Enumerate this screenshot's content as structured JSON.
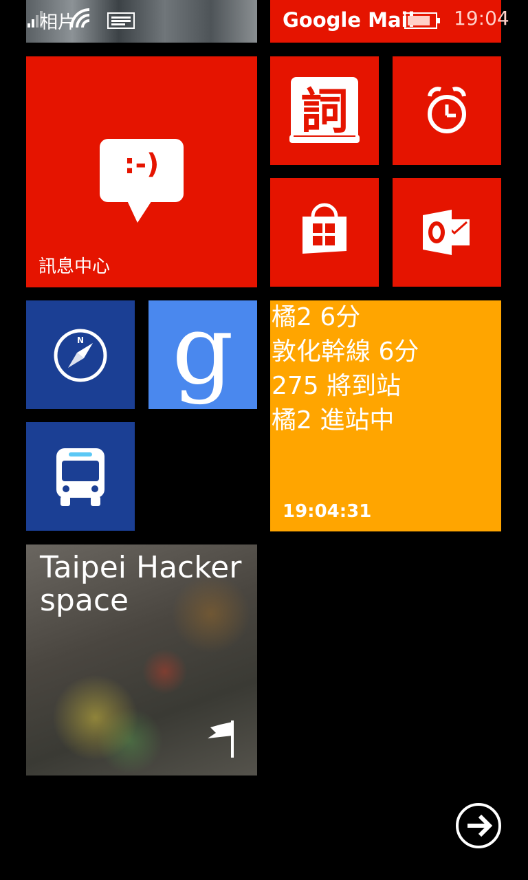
{
  "status_bar": {
    "time": "19:04"
  },
  "tiles": {
    "photos": {
      "label": "相片"
    },
    "gmail": {
      "label": "Google Mail"
    },
    "messaging": {
      "label": "訊息中心",
      "emoticon": ":-)"
    },
    "dictionary": {
      "glyph": "詞"
    },
    "google": {
      "glyph": "g"
    },
    "transit": {
      "lines": [
        "橘2 6分",
        "敦化幹線 6分",
        "275 將到站",
        "橘2 進站中"
      ],
      "updated_time": "19:04:31"
    },
    "hackerspace": {
      "label": "Taipei Hackerspace"
    }
  },
  "icons": {
    "signal": "signal-icon",
    "wifi": "wifi-icon",
    "message": "message-icon",
    "battery": "battery-icon",
    "alarm": "alarm-clock-icon",
    "store": "store-bag-icon",
    "outlook": "outlook-icon",
    "compass": "compass-icon",
    "bus": "bus-icon",
    "flag": "flag-icon",
    "arrow": "arrow-right-circle-icon"
  },
  "colors": {
    "accent_red": "#e51400",
    "tile_blue": "#1b3f94",
    "google_blue": "#4a88ee",
    "transit_orange": "#ffa500",
    "background": "#000000"
  }
}
